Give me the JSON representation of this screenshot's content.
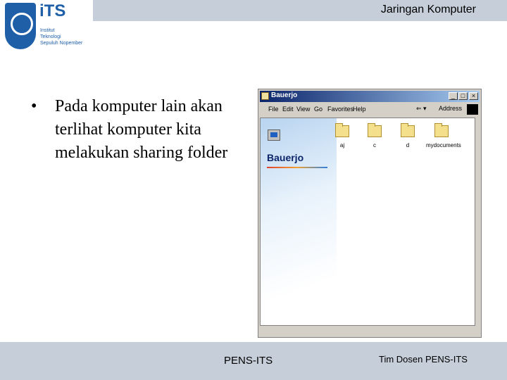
{
  "header": {
    "title": "Jaringan Komputer"
  },
  "logo": {
    "name": "iTS",
    "lines": [
      "Institut",
      "Teknologi",
      "Sepuluh Nopember"
    ]
  },
  "slide": {
    "bullet": "•",
    "text": "Pada komputer lain akan terlihat komputer kita melakukan sharing folder"
  },
  "window": {
    "title": "Bauerjo",
    "controls": {
      "minimize": "_",
      "maximize": "□",
      "close": "×"
    },
    "menu": [
      "File",
      "Edit",
      "View",
      "Go",
      "Favorites",
      "Help"
    ],
    "back_label": "⇐ ▾",
    "address_label": "Address",
    "sidebar_title": "Bauerjo",
    "folders": [
      "aj",
      "c",
      "d",
      "mydocuments"
    ]
  },
  "footer": {
    "center": "PENS-ITS",
    "right": "Tim Dosen PENS-ITS"
  },
  "colors": {
    "band": "#c5ced9",
    "titlebar": "#0a246a",
    "folder": "#f4e08c"
  }
}
